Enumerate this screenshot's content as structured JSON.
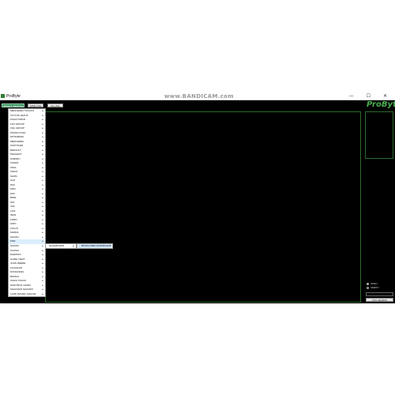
{
  "window": {
    "title": "ProByte",
    "watermark": "www.BANDICAM.com",
    "controls": "— ☐ ✕"
  },
  "toolbar": {
    "select_label": "SELECT VEHICLE",
    "save_label": "SAVE FILE",
    "hex_label": "hex view"
  },
  "logo": "ProByte",
  "menu": {
    "items": [
      {
        "label": "MERCEDES TRUCKS",
        "active": false
      },
      {
        "label": "TOYOTA LEXUS",
        "active": false
      },
      {
        "label": "KIA/HYUNDAI",
        "active": false
      },
      {
        "label": "FIAT GROUP",
        "active": false
      },
      {
        "label": "VAG GROUP",
        "active": false
      },
      {
        "label": "SSANGYONG",
        "active": false
      },
      {
        "label": "MITSUBISHI",
        "active": false
      },
      {
        "label": "MERCEDES",
        "active": false
      },
      {
        "label": "CHRYSLER",
        "active": false
      },
      {
        "label": "RENAULT",
        "active": false
      },
      {
        "label": "PEUGEOT",
        "active": false
      },
      {
        "label": "SUBARU",
        "active": false
      },
      {
        "label": "KAMAZ",
        "active": false
      },
      {
        "label": "URAL",
        "active": false
      },
      {
        "label": "IVECO",
        "active": false
      },
      {
        "label": "SAIPA",
        "active": false
      },
      {
        "label": "GAZ",
        "active": false
      },
      {
        "label": "PAZ",
        "active": false
      },
      {
        "label": "MAN",
        "active": false
      },
      {
        "label": "DAF",
        "active": false
      },
      {
        "label": "BMW",
        "active": false
      },
      {
        "label": "GM",
        "active": false
      },
      {
        "label": "VAZ",
        "active": false
      },
      {
        "label": "LIAZ",
        "active": false
      },
      {
        "label": "IRAN",
        "active": false
      },
      {
        "label": "FORD",
        "active": false
      },
      {
        "label": "HINO",
        "active": false
      },
      {
        "label": "VOLVO",
        "active": false
      },
      {
        "label": "MAZDA",
        "active": false
      },
      {
        "label": "HUDAH",
        "active": false
      },
      {
        "label": "FAW",
        "active": true
      },
      {
        "label": "SUZUKI",
        "active": false
      },
      {
        "label": "SCANIA",
        "active": false
      },
      {
        "label": "DAEWOO",
        "active": false
      },
      {
        "label": "GAZEL NEXT",
        "active": false
      },
      {
        "label": "JOHN DEERE",
        "active": false
      },
      {
        "label": "CHANGAN",
        "active": false
      },
      {
        "label": "DONGFENG",
        "active": false
      },
      {
        "label": "BOMAG",
        "active": false
      },
      {
        "label": "ISUZU TRUCK",
        "active": false
      },
      {
        "label": "SINOTRUK HOWO",
        "active": false
      },
      {
        "label": "SHACMAN SHAANXI",
        "active": false
      },
      {
        "label": "LAND ROVER JAGUAR",
        "active": false
      }
    ],
    "arrow": "▸"
  },
  "submenu": {
    "level1": "DASHBOARD",
    "level2": "BOSCH MED DASHBOARD"
  },
  "options": {
    "radio1": "OPEN",
    "radio2": "VERIFY"
  },
  "read_button": "CPU SEARCH"
}
